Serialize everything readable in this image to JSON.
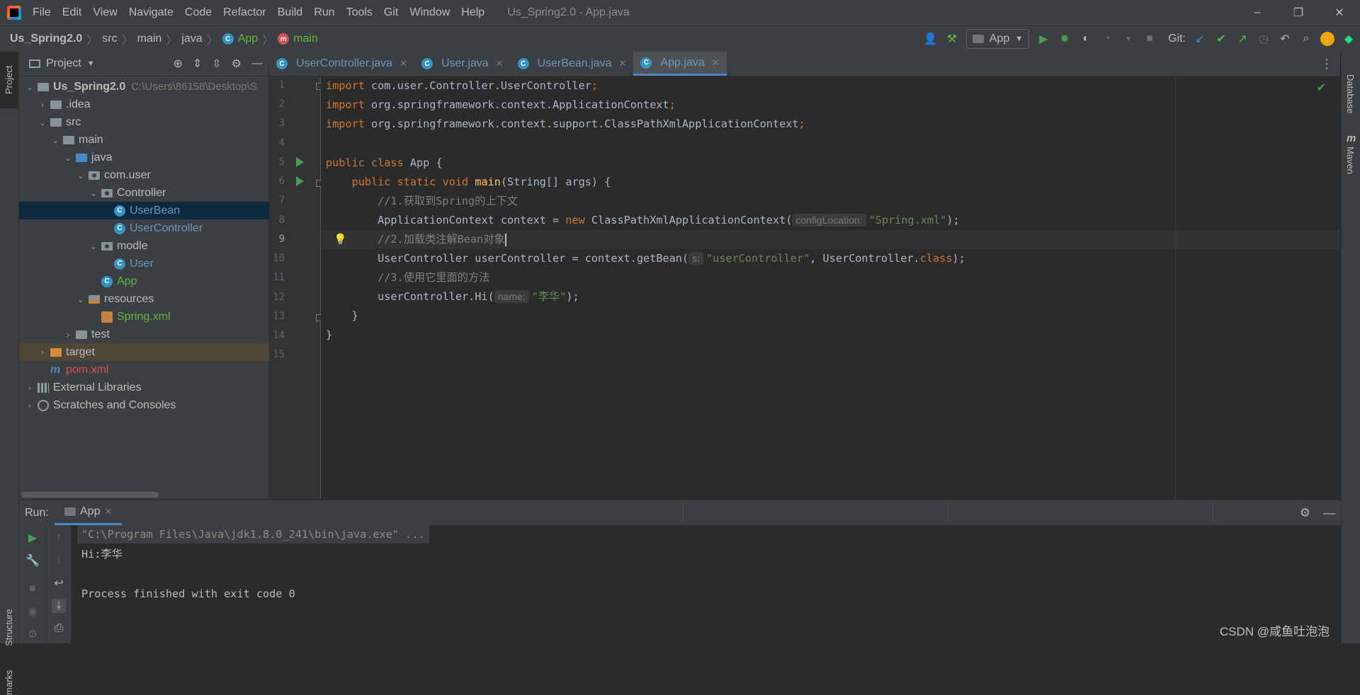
{
  "window": {
    "title": "Us_Spring2.0 - App.java",
    "menu": [
      "File",
      "Edit",
      "View",
      "Navigate",
      "Code",
      "Refactor",
      "Build",
      "Run",
      "Tools",
      "Git",
      "Window",
      "Help"
    ],
    "controls": [
      "–",
      "❐",
      "✕"
    ]
  },
  "breadcrumb": [
    "Us_Spring2.0",
    "src",
    "main",
    "java",
    "App",
    "main"
  ],
  "toolbar": {
    "run_config": "App",
    "git_label": "Git:"
  },
  "left_strip": {
    "project": "Project",
    "structure": "Structure",
    "bookmarks": "marks"
  },
  "right_strip": {
    "database": "Database",
    "maven": "Maven"
  },
  "project": {
    "header": "Project",
    "root_name": "Us_Spring2.0",
    "root_path": "C:\\Users\\86158\\Desktop\\S",
    "items": [
      {
        "label": ".idea"
      },
      {
        "label": "src"
      },
      {
        "label": "main"
      },
      {
        "label": "java"
      },
      {
        "label": "com.user"
      },
      {
        "label": "Controller"
      },
      {
        "label": "UserBean"
      },
      {
        "label": "UserController"
      },
      {
        "label": "modle"
      },
      {
        "label": "User"
      },
      {
        "label": "App"
      },
      {
        "label": "resources"
      },
      {
        "label": "Spring.xml"
      },
      {
        "label": "test"
      },
      {
        "label": "target"
      },
      {
        "label": "pom.xml"
      },
      {
        "label": "External Libraries"
      },
      {
        "label": "Scratches and Consoles"
      }
    ]
  },
  "tabs": [
    {
      "label": "UserController.java"
    },
    {
      "label": "User.java"
    },
    {
      "label": "UserBean.java"
    },
    {
      "label": "App.java"
    }
  ],
  "code": {
    "line_numbers": [
      "1",
      "2",
      "3",
      "4",
      "5",
      "6",
      "7",
      "8",
      "9",
      "10",
      "11",
      "12",
      "13",
      "14",
      "15"
    ],
    "l1_kw": "import",
    "l1_rest": " com.user.Controller.UserController",
    "semi": ";",
    "l2_rest": " org.springframework.context.ApplicationContext",
    "l3_rest": " org.springframework.context.support.ClassPathXmlApplicationContext",
    "l5_kw": "public class",
    "l5_rest": " App {",
    "l6_indent": "    ",
    "l6_kw": "public static void",
    "l6_fn": "main",
    "l6_rest": "(String[] args) {",
    "l7": "        //1.获取到Spring的上下文",
    "l8_a": "        ApplicationContext context = ",
    "l8_kw": "new",
    "l8_b": " ClassPathXmlApplicationContext(",
    "l8_hint": "configLocation:",
    "l8_str": "\"Spring.xml\"",
    "l8_end": ");",
    "l9": "        //2.加载类注解Bean对象",
    "l10_a": "        UserController userController = context.getBean(",
    "l10_hint": "s:",
    "l10_str": "\"userController\"",
    "l10_b": ", UserController.",
    "l10_kw": "class",
    "l10_end": ");",
    "l11": "        //3.使用它里面的方法",
    "l12_a": "        userController.Hi(",
    "l12_hint": "name:",
    "l12_str": "\"李华\"",
    "l12_end": ");",
    "l13": "    }",
    "l14": "}"
  },
  "run": {
    "label": "Run:",
    "tab": "App",
    "console": [
      "\"C:\\Program Files\\Java\\jdk1.8.0_241\\bin\\java.exe\" ...",
      "Hi:李华",
      "",
      "Process finished with exit code 0"
    ]
  },
  "watermark": "CSDN @咸鱼吐泡泡",
  "colors": {
    "accent": "#4a88c7",
    "run_green": "#499c54",
    "keyword": "#cc7832",
    "string": "#6a8759"
  }
}
